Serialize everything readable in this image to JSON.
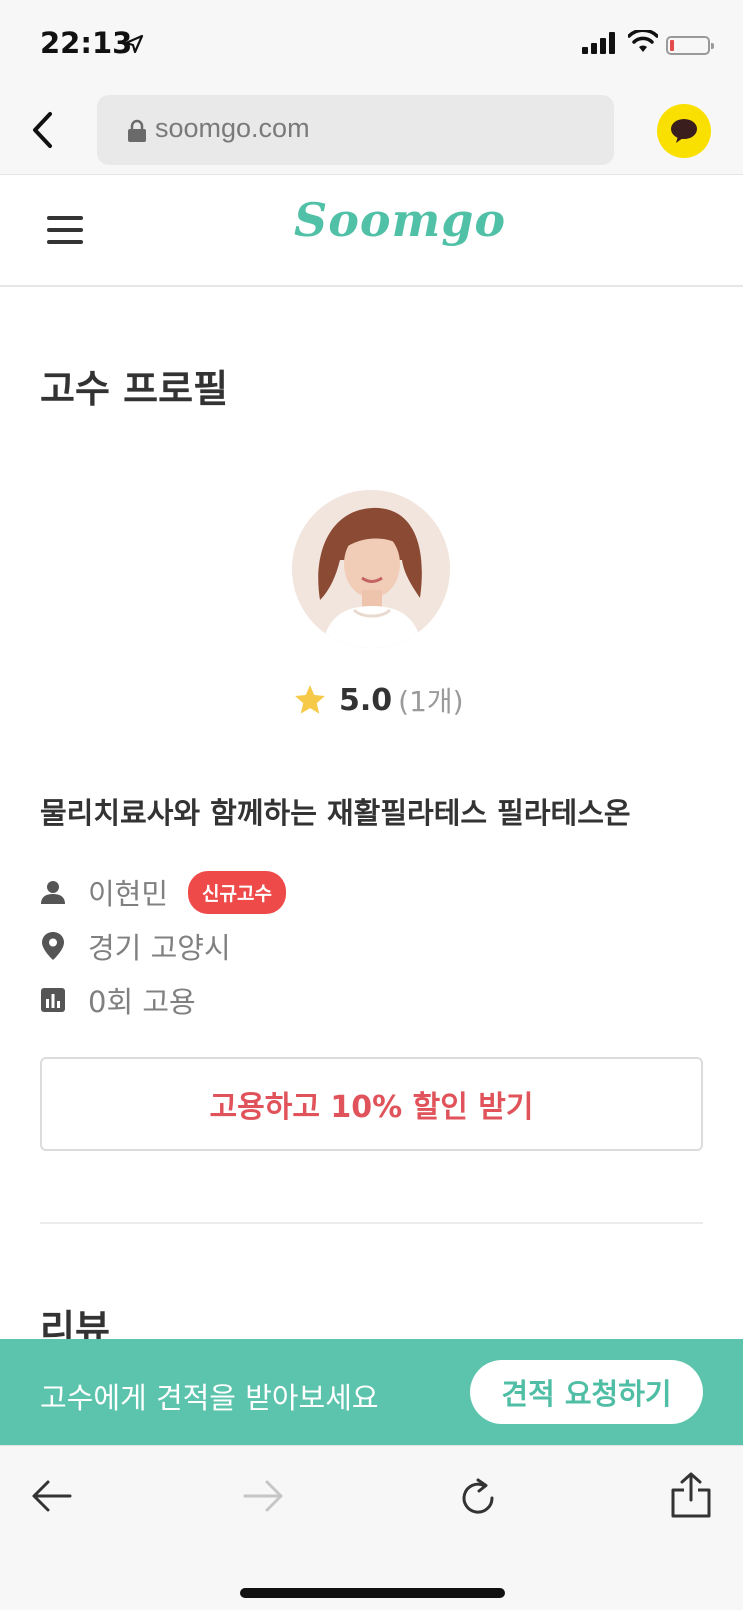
{
  "status_bar": {
    "time": "22:13"
  },
  "browser": {
    "url": "soomgo.com"
  },
  "app": {
    "logo": "Soomgo"
  },
  "page": {
    "title": "고수 프로필",
    "rating": {
      "value": "5.0",
      "count": "(1개)"
    },
    "service_title": "물리치료사와 함께하는 재활필라테스 필라테스온",
    "info": {
      "name": "이현민",
      "badge": "신규고수",
      "location": "경기 고양시",
      "hires": "0회 고용"
    },
    "discount_button": "고용하고 10% 할인 받기",
    "review_heading": "리뷰"
  },
  "cta": {
    "text": "고수에게 견적을 받아보세요",
    "button": "견적 요청하기"
  },
  "colors": {
    "brand_green": "#50c0a7",
    "cta_green": "#5cc4ad",
    "badge_red": "#ee4a4a",
    "discount_red": "#e0535a",
    "star_yellow": "#f7c948",
    "talk_yellow": "#f9e000"
  },
  "icons": [
    "location-arrow-icon",
    "signal-icon",
    "wifi-icon",
    "battery-icon",
    "back-chevron-icon",
    "lock-icon",
    "chat-bubble-icon",
    "menu-icon",
    "star-icon",
    "person-icon",
    "map-pin-icon",
    "bar-chart-icon",
    "arrow-left-icon",
    "arrow-right-icon",
    "reload-icon",
    "share-icon"
  ]
}
